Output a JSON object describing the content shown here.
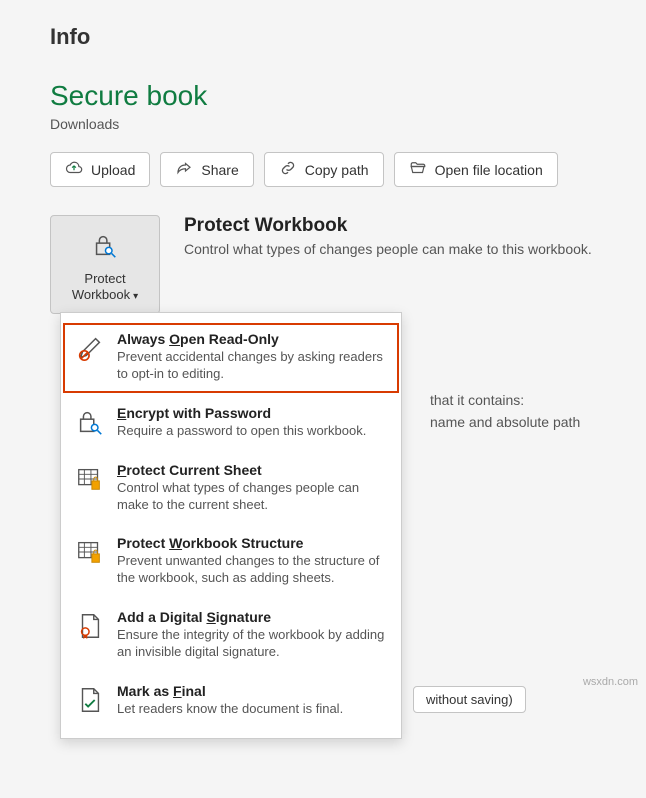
{
  "page": {
    "title": "Info"
  },
  "doc": {
    "title": "Secure book",
    "location": "Downloads"
  },
  "actions": {
    "upload": "Upload",
    "share": "Share",
    "copy_path": "Copy path",
    "open_location": "Open file location"
  },
  "protect": {
    "button_label": "Protect Workbook",
    "heading": "Protect Workbook",
    "description": "Control what types of changes people can make to this workbook."
  },
  "background": {
    "line1": "that it contains:",
    "line2": "name and absolute path",
    "close_btn": "without saving)"
  },
  "menu": [
    {
      "title_parts": [
        "Always ",
        "O",
        "pen Read-Only"
      ],
      "underline_index": 1,
      "desc": "Prevent accidental changes by asking readers to opt-in to editing.",
      "highlight": true
    },
    {
      "title_parts": [
        "E",
        "ncrypt with Password"
      ],
      "underline_index": 0,
      "desc": "Require a password to open this workbook."
    },
    {
      "title_parts": [
        "P",
        "rotect Current Sheet"
      ],
      "underline_index": 0,
      "desc": "Control what types of changes people can make to the current sheet."
    },
    {
      "title_parts": [
        "Protect ",
        "W",
        "orkbook Structure"
      ],
      "underline_index": 1,
      "desc": "Prevent unwanted changes to the structure of the workbook, such as adding sheets."
    },
    {
      "title_parts": [
        "Add a Digital ",
        "S",
        "ignature"
      ],
      "underline_index": 1,
      "desc": "Ensure the integrity of the workbook by adding an invisible digital signature."
    },
    {
      "title_parts": [
        "Mark as ",
        "F",
        "inal"
      ],
      "underline_index": 1,
      "desc": "Let readers know the document is final."
    }
  ],
  "watermark": "wsxdn.com"
}
